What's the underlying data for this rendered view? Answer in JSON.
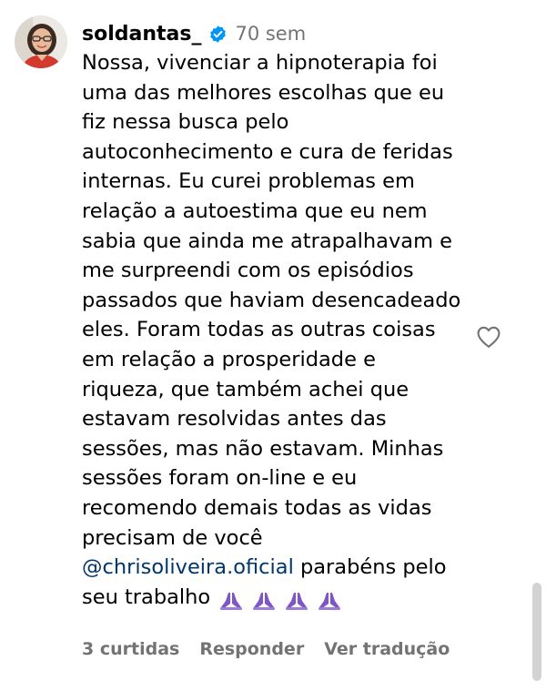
{
  "comment": {
    "username": "soldantas_",
    "time": "70 sem",
    "body_lines": [
      "Nossa, vivenciar a hipnoterapia foi",
      "uma das melhores escolhas que eu",
      "fiz nessa busca pelo",
      "autoconhecimento e cura de feridas",
      "internas. Eu curei problemas em",
      "relação a autoestima que eu nem",
      "sabia que ainda me atrapalhavam e",
      "me surpreendi com os episódios",
      "passados que haviam desencadeado",
      "eles. Foram todas as outras coisas",
      "em relação a prosperidade e",
      "riqueza, que também achei que",
      "estavam resolvidas antes das",
      "sessões, mas não estavam. Minhas",
      "sessões foram on-line e eu",
      "recomendo demais todas as vidas",
      "precisam de você"
    ],
    "mention": "@chrisoliveira.oficial",
    "after_mention": " parabéns pelo",
    "last_line": "seu trabalho",
    "emoji_count": 4,
    "emoji_name": "folded-hands-purple",
    "likes_label": "3 curtidas",
    "reply_label": "Responder",
    "translate_label": "Ver tradução"
  },
  "colors": {
    "text": "#000000",
    "secondary": "#737373",
    "mention": "#00376b",
    "verified": "#0095f6",
    "emoji": "#7f56c5"
  },
  "icons": {
    "verified": "verified-badge-icon",
    "like": "heart-outline-icon"
  }
}
